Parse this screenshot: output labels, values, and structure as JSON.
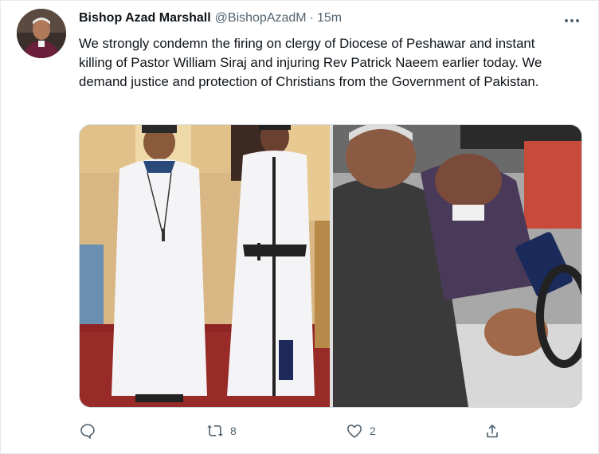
{
  "author": {
    "name": "Bishop Azad Marshall",
    "handle": "@BishopAzadM",
    "separator": "·",
    "time": "15m"
  },
  "tweet": {
    "text": "We strongly condemn the firing on clergy of Diocese of Peshawar and instant killing of Pastor William Siraj and injuring Rev Patrick Naeem earlier today. We demand justice and protection of Christians from the Government of Pakistan."
  },
  "media": {
    "photos": [
      {
        "description": "Two clergymen in white cassocks standing in a church"
      },
      {
        "description": "Wounded man embraced in a car seat"
      }
    ]
  },
  "actions": {
    "reply_count": "",
    "retweet_count": "8",
    "like_count": "2"
  },
  "icons": {
    "reply": "reply-icon",
    "retweet": "retweet-icon",
    "like": "like-icon",
    "share": "share-icon",
    "more": "more-icon"
  },
  "colors": {
    "secondary_text": "#536471",
    "border": "#cfd9de"
  }
}
